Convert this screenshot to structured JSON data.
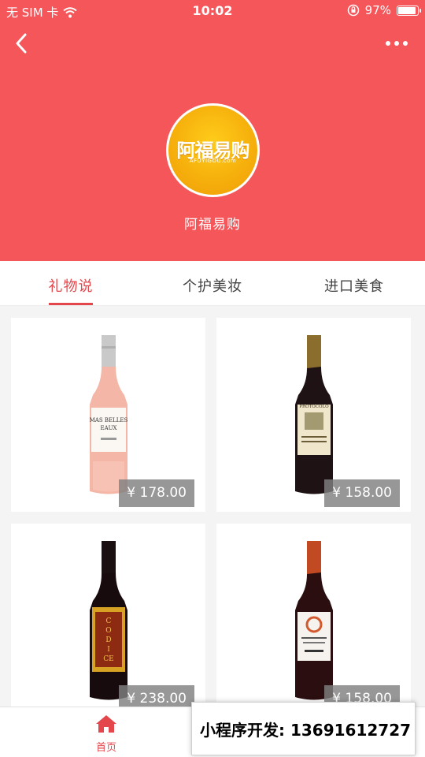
{
  "status_bar": {
    "carrier": "无 SIM 卡",
    "time": "10:02",
    "battery": "97%",
    "battery_level": 0.97
  },
  "header": {
    "logo_text": "阿福易购",
    "logo_subtext": "AFUYIGOU.com",
    "store_name": "阿福易购"
  },
  "tabs": [
    {
      "label": "礼物说",
      "active": true
    },
    {
      "label": "个护美妆",
      "active": false
    },
    {
      "label": "进口美食",
      "active": false
    }
  ],
  "products": [
    {
      "price": "¥ 178.00"
    },
    {
      "price": "¥ 158.00"
    },
    {
      "price": "¥ 238.00"
    },
    {
      "price": "¥ 158.00"
    }
  ],
  "bottom_nav": {
    "home_label": "首页"
  },
  "promo": {
    "text": "小程序开发: 13691612727"
  },
  "colors": {
    "header_bg": "#f5565a",
    "accent": "#e3474c",
    "logo_yellow": "#f6b00c"
  }
}
